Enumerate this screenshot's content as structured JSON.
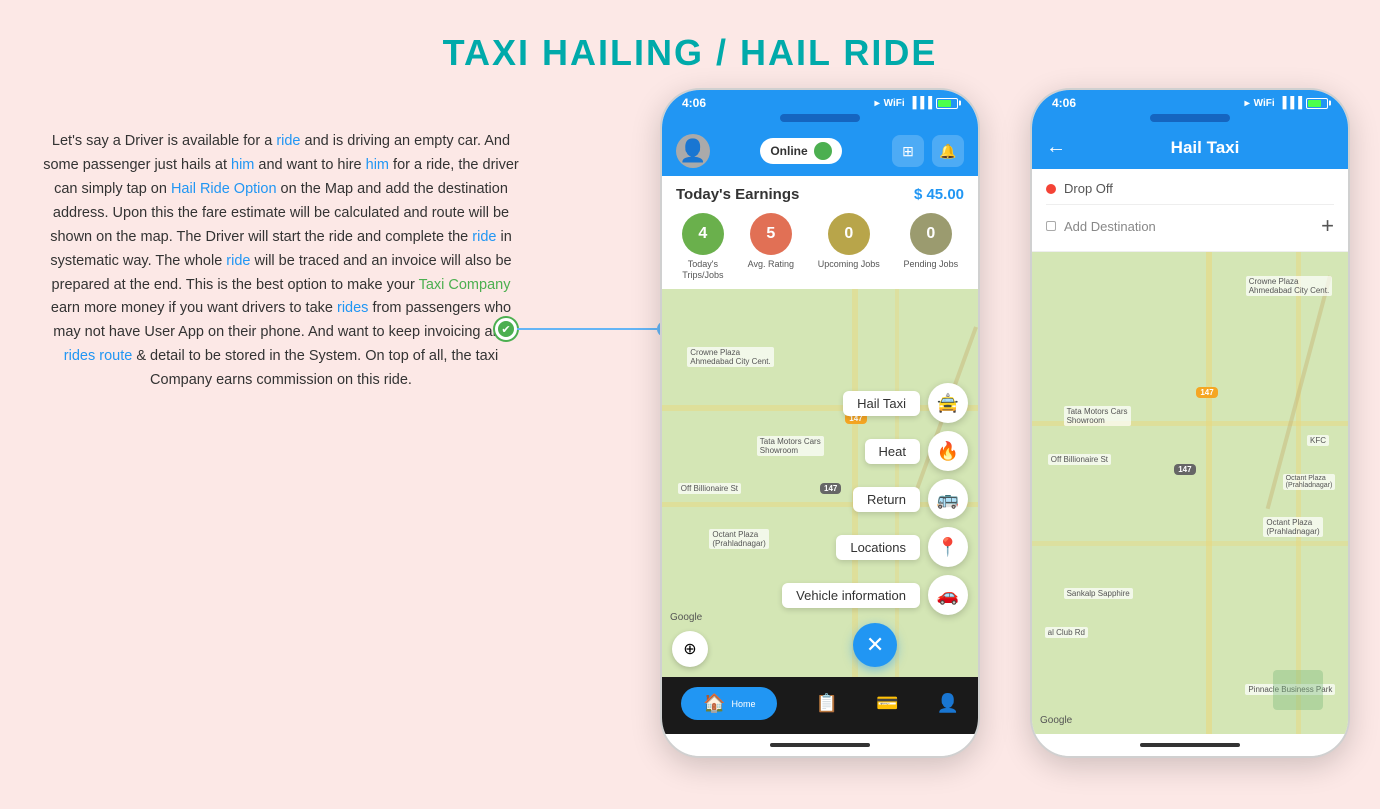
{
  "page": {
    "title": "TAXI HAILING / HAIL RIDE",
    "background_color": "#fce8e6"
  },
  "left_text": {
    "paragraph": "Let's say a Driver is available for a ride and is driving an empty car. And some passenger just hails at him and want to hire him for a ride, the driver can simply tap on Hail Ride Option on the Map and add the destination address. Upon this the fare estimate will be calculated and route will be shown on the map. The Driver will start the ride and complete the ride in systematic way. The whole ride will be traced and an invoice will also be prepared at the end. This is the best option to make your Taxi Company earn more money if you want drivers to take rides from passengers who may not have User App on their phone. And want to keep invoicing and rides route & detail to be stored in the System. On top of all, the taxi Company earns commission on this ride.",
    "highlight_words": [
      "ride",
      "him",
      "Hail Ride Option",
      "Taxi Company",
      "rides",
      "rides route"
    ]
  },
  "phone1": {
    "status_bar": {
      "time": "4:06",
      "location_icon": "▸",
      "wifi": "WiFi",
      "battery": "🔋"
    },
    "header": {
      "online_label": "Online",
      "icon1": "⊞",
      "icon2": "🔔"
    },
    "earnings": {
      "label": "Today's Earnings",
      "value": "$ 45.00"
    },
    "stats": [
      {
        "value": "4",
        "label": "Today's\nTrips/Jobs",
        "color": "#6ab04c"
      },
      {
        "value": "5",
        "label": "Avg. Rating",
        "color": "#e17055"
      },
      {
        "value": "0",
        "label": "Upcoming Jobs",
        "color": "#b8a54a"
      },
      {
        "value": "0",
        "label": "Pending Jobs",
        "color": "#9b9b6f"
      }
    ],
    "fab_menu": [
      {
        "label": "Hail Taxi",
        "icon": "🚕"
      },
      {
        "label": "Heat",
        "icon": "🔥"
      },
      {
        "label": "Return",
        "icon": "🏠"
      },
      {
        "label": "Locations",
        "icon": "📍"
      },
      {
        "label": "Vehicle information",
        "icon": "🚗"
      }
    ],
    "bottom_nav": [
      {
        "label": "Home",
        "icon": "🏠",
        "active": true
      },
      {
        "label": "",
        "icon": "📋",
        "active": false
      },
      {
        "label": "",
        "icon": "💳",
        "active": false
      },
      {
        "label": "",
        "icon": "👤",
        "active": false
      }
    ]
  },
  "phone2": {
    "status_bar": {
      "time": "4:06"
    },
    "header": {
      "back_label": "←",
      "title": "Hail Taxi"
    },
    "destination": {
      "drop_off_label": "Drop Off",
      "add_destination_label": "Add Destination",
      "plus_label": "+"
    },
    "google_label": "Google"
  },
  "connector": {
    "check_icon": "✔",
    "dot_color": "#64b5f6"
  }
}
